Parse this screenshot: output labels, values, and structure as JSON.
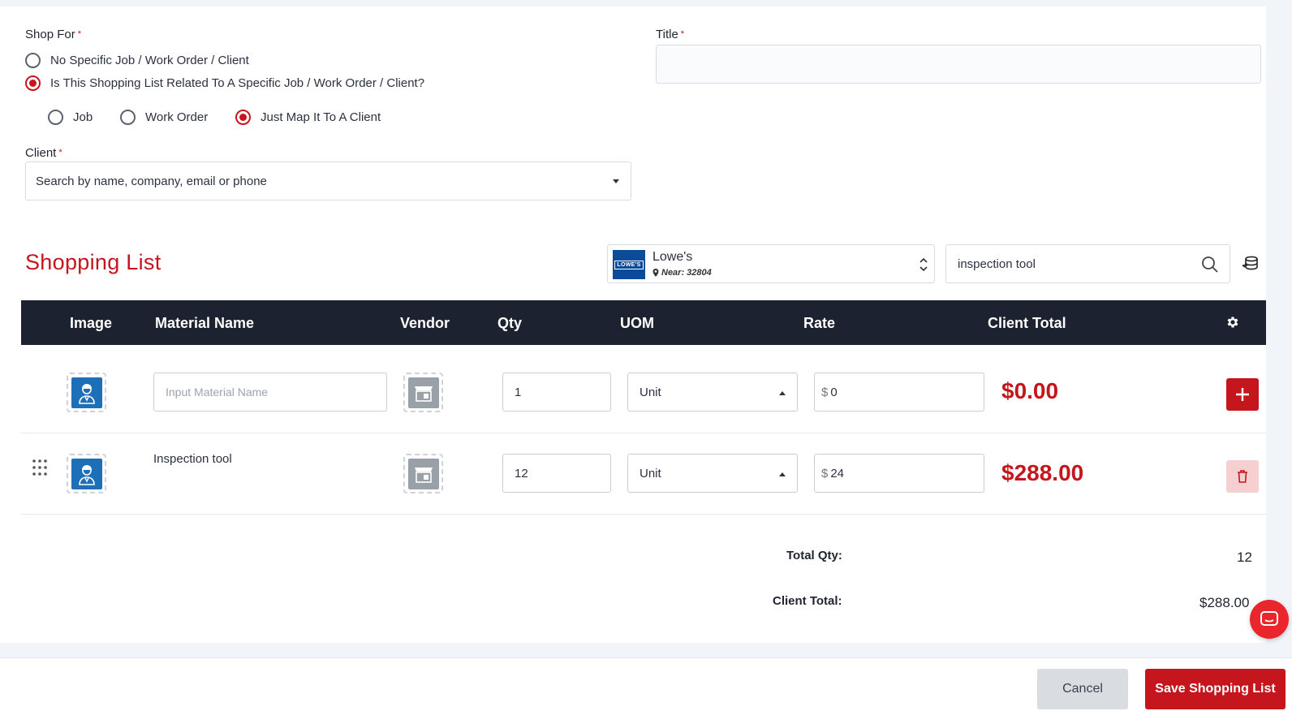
{
  "form": {
    "shop_for_label": "Shop For",
    "title_label": "Title",
    "required_mark": "*",
    "shop_for_options": [
      {
        "label": "No Specific Job / Work Order / Client",
        "selected": false
      },
      {
        "label": "Is This Shopping List Related To A Specific Job / Work Order / Client?",
        "selected": true
      }
    ],
    "related_options": [
      {
        "label": "Job",
        "selected": false
      },
      {
        "label": "Work Order",
        "selected": false
      },
      {
        "label": "Just Map It To A Client",
        "selected": true
      }
    ],
    "client_label": "Client",
    "client_placeholder": "Search by name, company, email or phone",
    "title_value": ""
  },
  "shopping_list": {
    "title": "Shopping List",
    "vendor": {
      "logo_text": "LOWE'S",
      "name": "Lowe's",
      "near": "Near: 32804"
    },
    "search_value": "inspection tool",
    "columns": [
      "Image",
      "Material Name",
      "Vendor",
      "Qty",
      "UOM",
      "Rate",
      "Client Total"
    ],
    "new_row": {
      "material_placeholder": "Input Material Name",
      "qty": "1",
      "uom": "Unit",
      "currency": "$",
      "rate": "0",
      "total": "$0.00"
    },
    "rows": [
      {
        "material": "Inspection tool",
        "qty": "12",
        "uom": "Unit",
        "currency": "$",
        "rate": "24",
        "total": "$288.00"
      }
    ],
    "totals": {
      "qty_label": "Total Qty:",
      "qty_value": "12",
      "client_total_label": "Client Total:",
      "client_total_value": "$288.00"
    }
  },
  "footer": {
    "cancel_label": "Cancel",
    "save_label": "Save Shopping List"
  },
  "colors": {
    "accent": "#c4161c",
    "header_bg": "#1c222f",
    "vendor_brand": "#0b4b9a"
  }
}
